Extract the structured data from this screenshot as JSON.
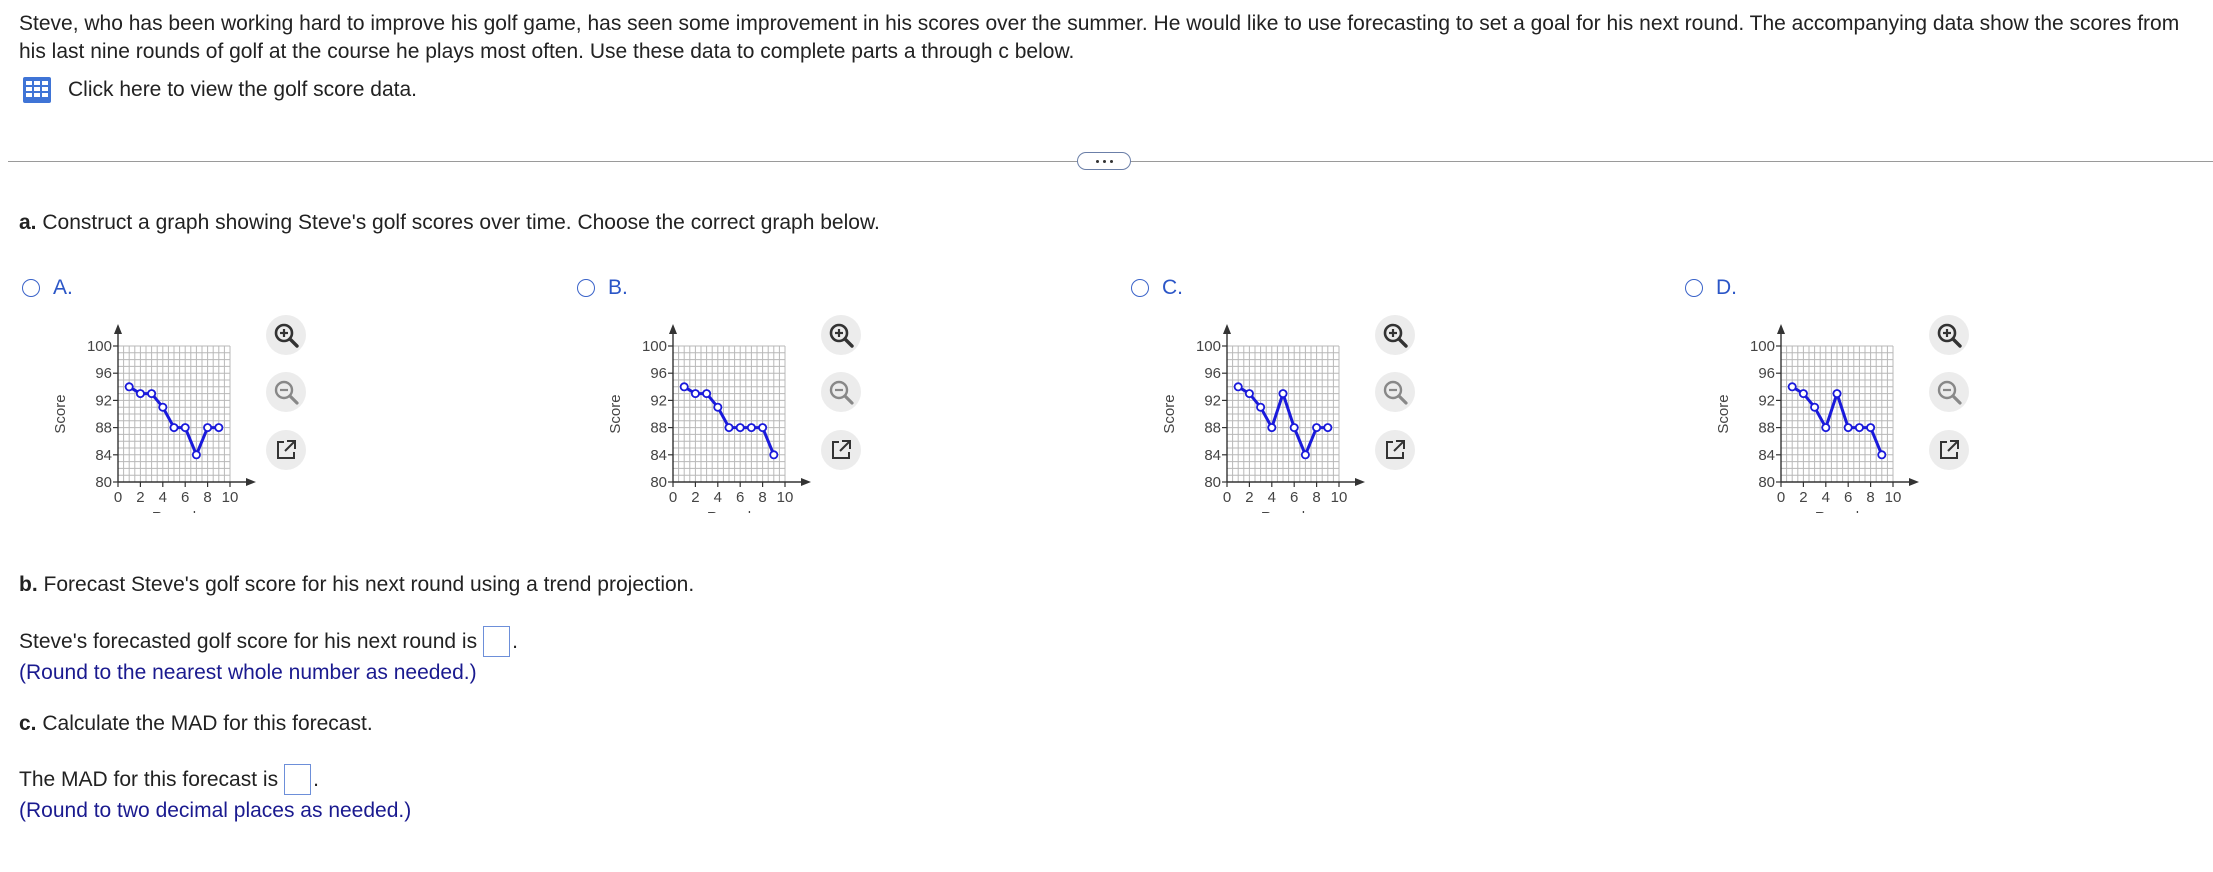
{
  "intro": {
    "text": "Steve, who has been working hard to improve his golf game, has seen some improvement in his scores over the summer. He would like to use forecasting to set a goal for his next round. The accompanying data show the scores from his last nine rounds of golf at the course he plays most often. Use these data to complete parts a through c below.",
    "data_link": "Click here to view the golf score data."
  },
  "part_a": {
    "label": "a.",
    "text": "Construct a graph showing Steve's golf scores over time. Choose the correct graph below."
  },
  "options": [
    {
      "letter": "A.",
      "chart_data": {
        "type": "line",
        "xlabel": "Round",
        "ylabel": "Score",
        "xlim": [
          0,
          10
        ],
        "ylim": [
          80,
          100
        ],
        "xticks": [
          "0",
          "2",
          "4",
          "6",
          "8",
          "10"
        ],
        "yticks": [
          "80",
          "84",
          "88",
          "92",
          "96",
          "100"
        ],
        "x": [
          1,
          2,
          3,
          4,
          5,
          6,
          7,
          8,
          9
        ],
        "values": [
          94,
          93,
          93,
          91,
          88,
          88,
          84,
          88,
          88
        ]
      }
    },
    {
      "letter": "B.",
      "chart_data": {
        "type": "line",
        "xlabel": "Round",
        "ylabel": "Score",
        "xlim": [
          0,
          10
        ],
        "ylim": [
          80,
          100
        ],
        "xticks": [
          "0",
          "2",
          "4",
          "6",
          "8",
          "10"
        ],
        "yticks": [
          "80",
          "84",
          "88",
          "92",
          "96",
          "100"
        ],
        "x": [
          1,
          2,
          3,
          4,
          5,
          6,
          7,
          8,
          9
        ],
        "values": [
          94,
          93,
          93,
          91,
          88,
          88,
          88,
          88,
          84
        ]
      }
    },
    {
      "letter": "C.",
      "chart_data": {
        "type": "line",
        "xlabel": "Round",
        "ylabel": "Score",
        "xlim": [
          0,
          10
        ],
        "ylim": [
          80,
          100
        ],
        "xticks": [
          "0",
          "2",
          "4",
          "6",
          "8",
          "10"
        ],
        "yticks": [
          "80",
          "84",
          "88",
          "92",
          "96",
          "100"
        ],
        "x": [
          1,
          2,
          3,
          4,
          5,
          6,
          7,
          8,
          9
        ],
        "values": [
          94,
          93,
          91,
          88,
          93,
          88,
          84,
          88,
          88
        ]
      }
    },
    {
      "letter": "D.",
      "chart_data": {
        "type": "line",
        "xlabel": "Round",
        "ylabel": "Score",
        "xlim": [
          0,
          10
        ],
        "ylim": [
          80,
          100
        ],
        "xticks": [
          "0",
          "2",
          "4",
          "6",
          "8",
          "10"
        ],
        "yticks": [
          "80",
          "84",
          "88",
          "92",
          "96",
          "100"
        ],
        "x": [
          1,
          2,
          3,
          4,
          5,
          6,
          7,
          8,
          9
        ],
        "values": [
          94,
          93,
          91,
          88,
          93,
          88,
          88,
          88,
          84
        ]
      }
    }
  ],
  "part_b": {
    "label": "b.",
    "text": "Forecast Steve's golf score for his next round using a trend projection.",
    "answer_line": "Steve's forecasted golf score for his next round is",
    "hint": "(Round to the nearest whole number as needed.)"
  },
  "part_c": {
    "label": "c.",
    "text": "Calculate the MAD for this forecast.",
    "answer_line": "The MAD for this forecast is",
    "hint": "(Round to two decimal places as needed.)"
  },
  "punctuation": ".",
  "colors": {
    "series": "#1a1adb",
    "accent": "#2b56c7",
    "hint": "#1a1a8f"
  },
  "icons": {
    "data": "table-icon",
    "zoom_in": "zoom-in-icon",
    "zoom_out": "zoom-out-icon",
    "popout": "popout-icon"
  }
}
